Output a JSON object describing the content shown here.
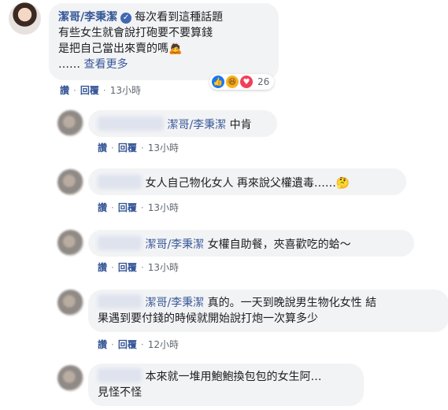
{
  "main_comment": {
    "author": "潔哥/李秉潔",
    "lines": [
      "每次看到這種話題",
      "有些女生就會說打砲要不要算錢",
      "是把自己當出來賣的嗎"
    ],
    "emoji": "🙇",
    "ellipsis": "……",
    "see_more": "查看更多",
    "reaction_count": "26",
    "like_label": "讚",
    "reply_label": "回覆",
    "time": "13小時"
  },
  "replies": [
    {
      "mention": "潔哥/李秉潔",
      "text": " 中肯",
      "like_label": "讚",
      "reply_label": "回覆",
      "time": "13小時"
    },
    {
      "mention": "",
      "text": "女人自己物化女人 再來說父權遺毒……",
      "emoji": "🤔",
      "like_label": "讚",
      "reply_label": "回覆",
      "time": "13小時"
    },
    {
      "mention": "潔哥/李秉潔",
      "text": " 女權自助餐，夾喜歡吃的蛤～",
      "like_label": "讚",
      "reply_label": "回覆",
      "time": "13小時"
    },
    {
      "mention": "潔哥/李秉潔",
      "text": " 真的。一天到晚說男生物化女性 結",
      "line2": "果遇到要付錢的時候就開始說打炮一次算多少",
      "like_label": "讚",
      "reply_label": "回覆",
      "time": "12小時"
    },
    {
      "mention": "",
      "text": "本來就一堆用鮑鮑換包包的女生阿…",
      "line2": "見怪不怪"
    }
  ]
}
